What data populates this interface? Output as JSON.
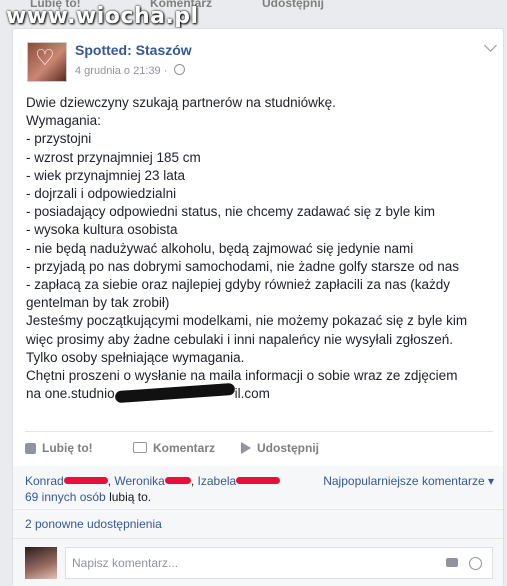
{
  "top_actions": {
    "like": "Lubię to!",
    "comment": "Komentarz",
    "share": "Udostępnij"
  },
  "watermark": "www.wiocha.pl",
  "post": {
    "page_name": "Spotted: Staszów",
    "date": "4 grudnia o 21:39",
    "lines": [
      "Dwie dziewczyny szukają partnerów na studniówkę.",
      "Wymagania:",
      "- przystojni",
      "- wzrost przynajmniej 185 cm",
      "- wiek przynajmniej 23 lata",
      "- dojrzali i odpowiedzialni",
      "- posiadający odpowiedni status, nie chcemy zadawać się z byle kim",
      "- wysoka kultura osobista",
      "- nie będą nadużywać alkoholu, będą zajmować się jedynie nami",
      "- przyjadą po nas dobrymi samochodami, nie żadne golfy starsze od nas",
      "- zapłacą za siebie oraz najlepiej gdyby również zapłacili za nas (każdy",
      "gentelman by tak zrobił)",
      "Jesteśmy początkującymi modelkami, nie możemy pokazać się z byle kim",
      "więc prosimy aby żadne cebulaki i inni napaleńcy nie wysyłali zgłoszeń.",
      "Tylko osoby spełniające wymagania.",
      "Chętni proszeni o wysłanie na maila informacji o sobie wraz ze zdjęciem"
    ],
    "email_prefix": "na one.studnio",
    "email_suffix": "il.com"
  },
  "actions": {
    "like": "Lubię to!",
    "comment": "Komentarz",
    "share": "Udostępnij"
  },
  "likes": {
    "name1": "Konrad",
    "name2": "Weronika",
    "name3": "Izabela",
    "others_link": "69 innych osób",
    "suffix": " lubią to.",
    "most_popular": "Najpopularniejsze komentarze ▾"
  },
  "shares": "2 ponowne udostępnienia",
  "comment_input": {
    "placeholder": "Napisz komentarz..."
  }
}
